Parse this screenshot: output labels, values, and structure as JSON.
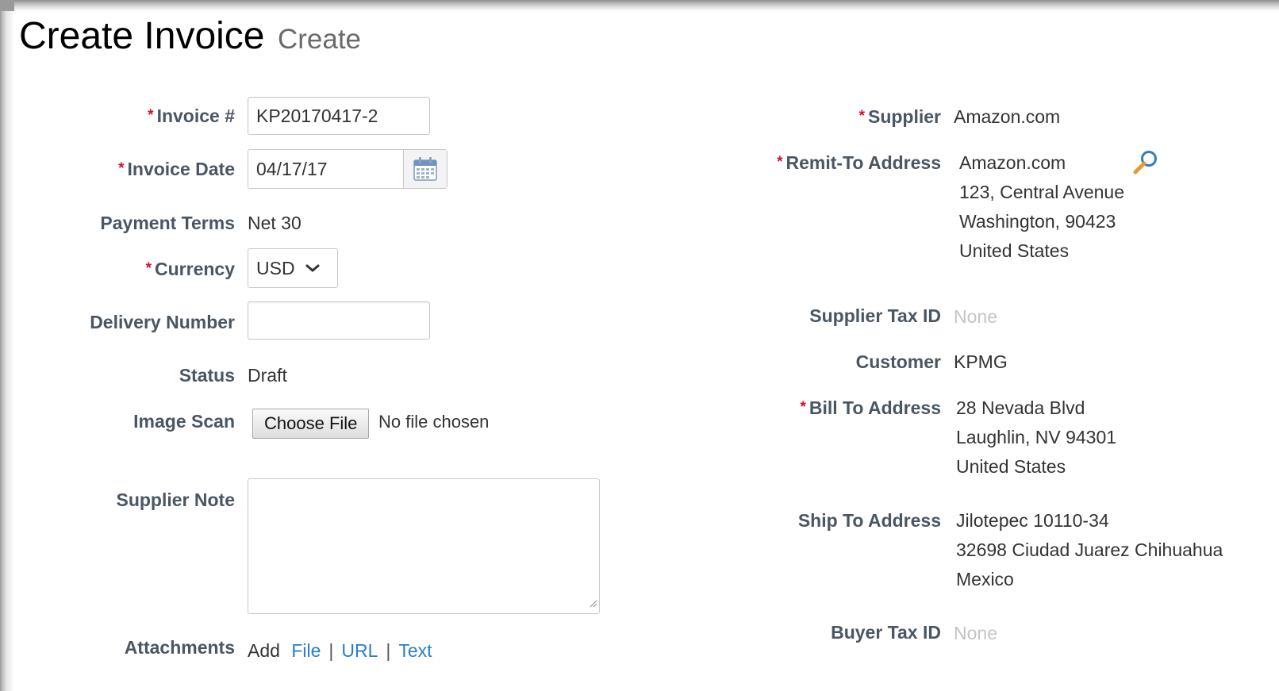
{
  "page": {
    "title": "Create Invoice",
    "subtitle": "Create"
  },
  "required_marker": "*",
  "left": {
    "invoice_number": {
      "label": "Invoice #",
      "value": "KP20170417-2"
    },
    "invoice_date": {
      "label": "Invoice Date",
      "value": "04/17/17",
      "icon": "calendar-icon"
    },
    "payment_terms": {
      "label": "Payment Terms",
      "value": "Net 30"
    },
    "currency": {
      "label": "Currency",
      "selected": "USD",
      "icon": "chevron-down-icon"
    },
    "delivery_number": {
      "label": "Delivery Number",
      "value": ""
    },
    "status": {
      "label": "Status",
      "value": "Draft"
    },
    "image_scan": {
      "label": "Image Scan",
      "button": "Choose File",
      "file_status": "No file chosen"
    },
    "supplier_note": {
      "label": "Supplier Note",
      "value": ""
    },
    "attachments": {
      "label": "Attachments",
      "prefix": "Add",
      "links": [
        "File",
        "URL",
        "Text"
      ],
      "separator": "|"
    }
  },
  "right": {
    "supplier": {
      "label": "Supplier",
      "value": "Amazon.com"
    },
    "remit_to": {
      "label": "Remit-To Address",
      "lines": [
        "Amazon.com",
        "123, Central Avenue",
        "Washington, 90423",
        "United States"
      ],
      "icon": "search-icon"
    },
    "supplier_tax_id": {
      "label": "Supplier Tax ID",
      "value": "None"
    },
    "customer": {
      "label": "Customer",
      "value": "KPMG"
    },
    "bill_to": {
      "label": "Bill To Address",
      "lines": [
        "28 Nevada Blvd",
        "Laughlin, NV 94301",
        "United States"
      ]
    },
    "ship_to": {
      "label": "Ship To Address",
      "lines": [
        "Jilotepec 10110-34",
        "32698 Ciudad Juarez Chihuahua",
        "Mexico"
      ]
    },
    "buyer_tax_id": {
      "label": "Buyer Tax ID",
      "value": "None"
    }
  },
  "colors": {
    "label": "#4a5662",
    "required": "#d0112b",
    "link": "#2a7ec6",
    "muted": "#c4c4c4"
  }
}
